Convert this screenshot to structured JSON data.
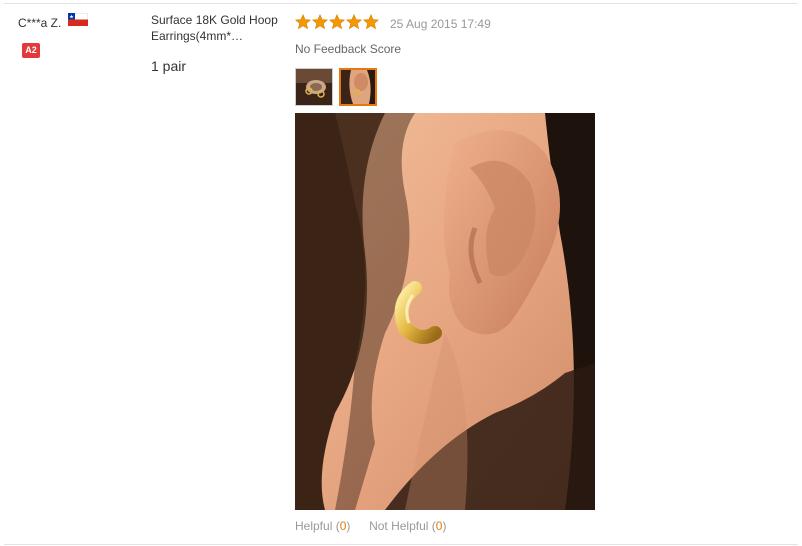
{
  "buyer": {
    "name": "C***a Z.",
    "country_icon": "flag-chile-icon",
    "level_badge": "A2",
    "badge_color": "#e4393c"
  },
  "product": {
    "title": "Surface 18K Gold Hoop Earrings(4mm*…",
    "quantity": "1 pair"
  },
  "review": {
    "rating": 5,
    "rating_max": 5,
    "star_color": "#f39800",
    "date": "25 Aug 2015 17:49",
    "feedback_score": "No Feedback Score",
    "thumbnails": [
      "photo-thumbnail-1",
      "photo-thumbnail-2"
    ],
    "selected_thumbnail": 2
  },
  "actions": {
    "helpful_label": "Helpful (",
    "helpful_count": "0",
    "helpful_close": ")",
    "not_helpful_label": "Not Helpful (",
    "not_helpful_count": "0",
    "not_helpful_close": ")",
    "count_color": "#e47911"
  }
}
